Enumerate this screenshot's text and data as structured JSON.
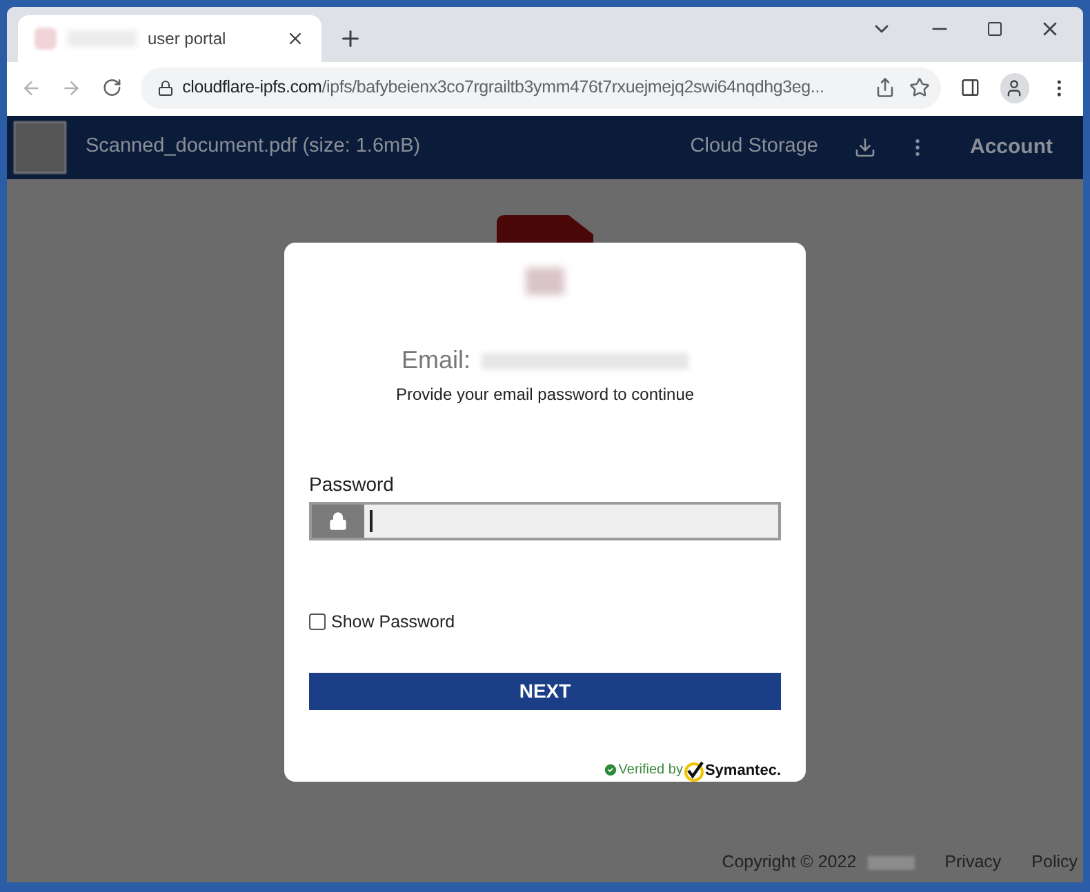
{
  "browser": {
    "tab_title": "user portal",
    "url_domain": "cloudflare-ipfs.com",
    "url_path": "/ipfs/bafybeienx3co7rgrailtb3ymm476t7rxuejmejq2swi64nqdhg3eg..."
  },
  "header": {
    "file_name": "Scanned_document.pdf (size: 1.6mB)",
    "cloud_storage": "Cloud Storage",
    "account": "Account"
  },
  "dialog": {
    "email_label": "Email:",
    "instruction": "Provide your email password to continue",
    "password_label": "Password",
    "show_password": {
      "label": "Show Password",
      "checked": false
    },
    "next_button": "NEXT",
    "verified_by": "Verified by",
    "brand": "Symantec."
  },
  "footer": {
    "copyright": "Copyright © 2022",
    "links": [
      "Privacy",
      "Policy"
    ]
  }
}
